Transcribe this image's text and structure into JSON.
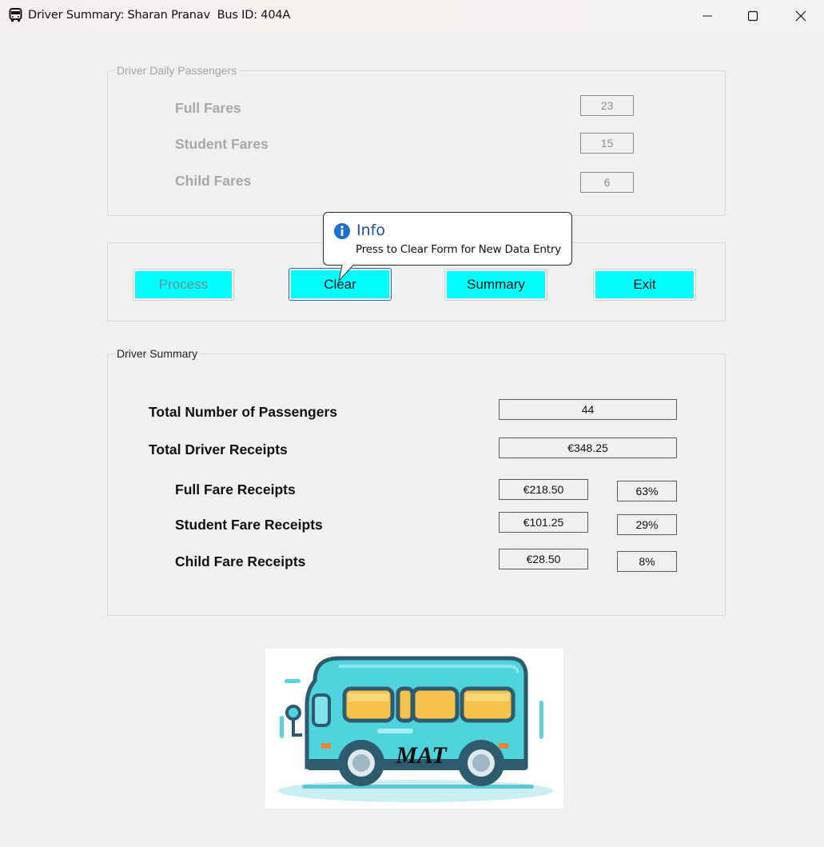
{
  "window": {
    "title": "Driver Summary: Sharan Pranav  Bus ID: 404A",
    "app_icon": "bus-icon",
    "controls": [
      "minimize-icon",
      "maximize-icon",
      "close-icon"
    ]
  },
  "daily_passengers": {
    "legend": "Driver Daily Passengers",
    "full_label": "Full Fares",
    "full_value": "23",
    "student_label": "Student Fares",
    "student_value": "15",
    "child_label": "Child Fares",
    "child_value": "6"
  },
  "buttons": {
    "process": "Process",
    "clear": "Clear",
    "summary": "Summary",
    "exit": "Exit"
  },
  "tooltip": {
    "icon": "info-icon",
    "title": "Info",
    "text": "Press to Clear Form for New Data Entry"
  },
  "summary": {
    "legend": "Driver Summary",
    "total_passengers_label": "Total Number of Passengers",
    "total_passengers_value": "44",
    "total_receipts_label": "Total Driver Receipts",
    "total_receipts_value": "€348.25",
    "full_label": "Full Fare Receipts",
    "full_value": "€218.50",
    "full_pct": "63%",
    "student_label": "Student Fare Receipts",
    "student_value": "€101.25",
    "student_pct": "29%",
    "child_label": "Child Fare Receipts",
    "child_value": "€28.50",
    "child_pct": "8%"
  },
  "logo": {
    "text": "MAT",
    "colors": {
      "body": "#4fd3dc",
      "window": "#f7c24a",
      "outline": "#2f5b6e"
    }
  },
  "colors": {
    "button": "#00ffff",
    "info_title": "#1f4fa8"
  }
}
